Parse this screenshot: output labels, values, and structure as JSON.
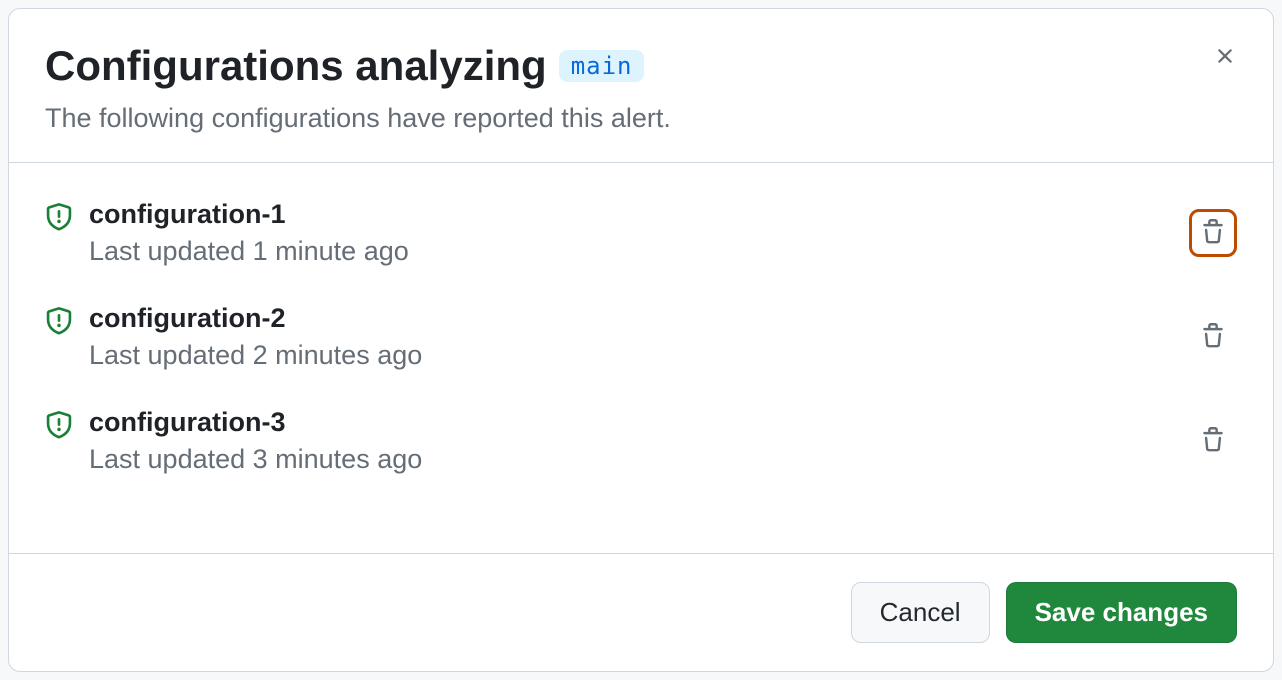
{
  "header": {
    "title": "Configurations analyzing",
    "branch": "main",
    "subtitle": "The following configurations have reported this alert."
  },
  "configurations": [
    {
      "name": "configuration-1",
      "meta": "Last updated 1 minute ago",
      "highlighted": true
    },
    {
      "name": "configuration-2",
      "meta": "Last updated 2 minutes ago",
      "highlighted": false
    },
    {
      "name": "configuration-3",
      "meta": "Last updated 3 minutes ago",
      "highlighted": false
    }
  ],
  "footer": {
    "cancel": "Cancel",
    "save": "Save changes"
  }
}
